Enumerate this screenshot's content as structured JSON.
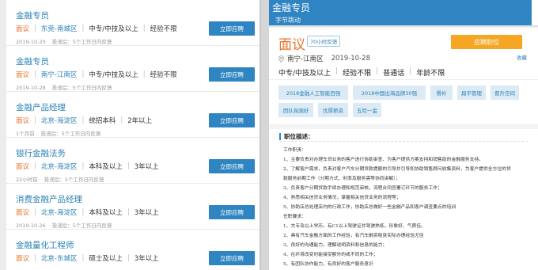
{
  "list": {
    "apply_label": "立即应聘",
    "jobs": [
      {
        "title": "金融专员",
        "salary": "面议",
        "location": "东莞-南城区",
        "edu": "中专/中技及以上",
        "exp": "经验不限",
        "date": "2019-10-20",
        "note": "投递后：5个工作日内反馈"
      },
      {
        "title": "金融专员",
        "salary": "面议",
        "location": "南宁-江南区",
        "edu": "中专/中技及以上",
        "exp": "经验不限",
        "date": "2019-10-28",
        "note": "投递后：5个工作日内反馈"
      },
      {
        "title": "金融产品经理",
        "salary": "面议",
        "location": "北京-海淀区",
        "edu": "统招本科",
        "exp": "2年以上",
        "date": "1个月前",
        "note": "投递后：5个工作日内反馈"
      },
      {
        "title": "银行金融法务",
        "salary": "面议",
        "location": "北京-海淀区",
        "edu": "本科及以上",
        "exp": "3年以上",
        "date": "22小时前",
        "note": "投递后：5个工作日内反馈"
      },
      {
        "title": "消费金融产品经理",
        "salary": "面议",
        "location": "北京-海淀区",
        "edu": "本科及以上",
        "exp": "3年以上",
        "date": "2019-10-26",
        "note": "投递后：5个工作日内反馈"
      },
      {
        "title": "金融量化工程师",
        "salary": "面议",
        "location": "北京-东城区",
        "edu": "硕士及以上",
        "exp": "3年以上",
        "date": "",
        "note": ""
      }
    ]
  },
  "detail": {
    "header_title": "金融专员",
    "company": "字节跳动",
    "salary": "面议",
    "badge": "70小时反馈",
    "apply_label": "应聘职位",
    "collect_label": "收藏",
    "location": "南宁-江南区",
    "date": "2019-10-28",
    "requirements": [
      "中专/中技及以上",
      "经验不限",
      "普通话",
      "年龄不限"
    ],
    "tags": [
      "2018金融人工智能百强",
      "2018中国出海品牌30强",
      "餐补",
      "扁平管理",
      "晋升空间",
      "团队氛围好",
      "优厚薪资",
      "五险一金"
    ],
    "desc_heading": "职位描述：",
    "desc_lines": [
      "工作职责：",
      "1、主要负责对办理车贷业务的客户进行协助审查、为客户提供方案支持和销售助的金融服务支持。",
      "2、了解客户需求，负责对客户汽车分期贷款提额的引导并引导和协助销售顾问收集资料，为客户提供全方位的贷",
      "款服务前期工作（分期方式、利率及服务需等协同讲解）；",
      "3、负责客户分期贷款手续办理和规范审核，流程合同签署订环节的服务工作；",
      "4、熟悉相关信贷业务情况，掌握相关信贷业务的流程等；",
      "5、协助店总处理店内的行政工作，协助店总做好一些金融产品和客户调查要点的培训",
      "任职要求：",
      "1、大专及以上学历，有C1以上驾驶证并驾驶熟练，形象好、气质佳。",
      "2、具有汽车金融方面的工作经验，有汽车融资租赁实际办理经验尤佳",
      "3、良好的沟通能力，理解说明资料和信息的能力；",
      "4、在环境改变时能接受额外的或不同的工作；",
      "5、有团队协作能力，有良好的客户服务意识"
    ]
  }
}
